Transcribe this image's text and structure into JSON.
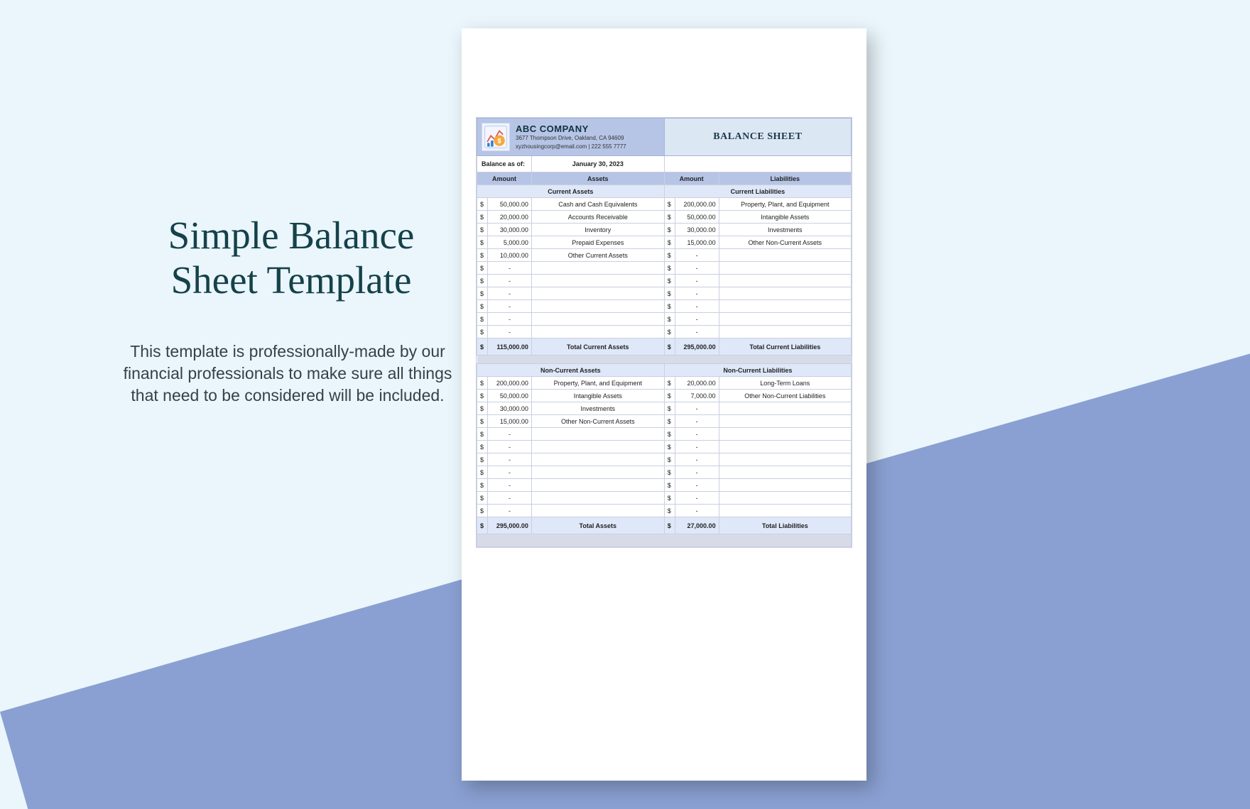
{
  "page": {
    "title": "Simple Balance Sheet Template",
    "description": "This template is professionally-made by our financial professionals to make sure all things that need to be considered will be included."
  },
  "header": {
    "company": "ABC COMPANY",
    "address": "3677 Thompson Drive, Oakland, CA 94609",
    "contact": "xyzhousingcorp@email.com | 222 555 7777",
    "doc_title": "BALANCE SHEET"
  },
  "info": {
    "label": "Balance as of:",
    "date": "January 30, 2023"
  },
  "columns": {
    "amount": "Amount",
    "assets": "Assets",
    "liabilities": "Liabilities"
  },
  "sections": {
    "current_assets": "Current Assets",
    "current_liabilities": "Current Liabilities",
    "non_current_assets": "Non-Current Assets",
    "non_current_liabilities": "Non-Current Liabilities"
  },
  "totals": {
    "tca_label": "Total Current Assets",
    "tca_amount": "115,000.00",
    "tcl_label": "Total Current Liabilities",
    "tcl_amount": "295,000.00",
    "ta_label": "Total Assets",
    "ta_amount": "295,000.00",
    "tl_label": "Total Liabilities",
    "tl_amount": "27,000.00"
  },
  "currency": "$",
  "dash": "-",
  "ca": [
    {
      "amt": "50,000.00",
      "lbl": "Cash and Cash Equivalents"
    },
    {
      "amt": "20,000.00",
      "lbl": "Accounts Receivable"
    },
    {
      "amt": "30,000.00",
      "lbl": "Inventory"
    },
    {
      "amt": "5,000.00",
      "lbl": "Prepaid Expenses"
    },
    {
      "amt": "10,000.00",
      "lbl": "Other Current Assets"
    },
    {
      "amt": "-",
      "lbl": ""
    },
    {
      "amt": "-",
      "lbl": ""
    },
    {
      "amt": "-",
      "lbl": ""
    },
    {
      "amt": "-",
      "lbl": ""
    },
    {
      "amt": "-",
      "lbl": ""
    },
    {
      "amt": "-",
      "lbl": ""
    }
  ],
  "cl": [
    {
      "amt": "200,000.00",
      "lbl": "Property, Plant, and Equipment"
    },
    {
      "amt": "50,000.00",
      "lbl": "Intangible Assets"
    },
    {
      "amt": "30,000.00",
      "lbl": "Investments"
    },
    {
      "amt": "15,000.00",
      "lbl": "Other Non-Current Assets"
    },
    {
      "amt": "-",
      "lbl": ""
    },
    {
      "amt": "-",
      "lbl": ""
    },
    {
      "amt": "-",
      "lbl": ""
    },
    {
      "amt": "-",
      "lbl": ""
    },
    {
      "amt": "-",
      "lbl": ""
    },
    {
      "amt": "-",
      "lbl": ""
    },
    {
      "amt": "-",
      "lbl": ""
    }
  ],
  "nca": [
    {
      "amt": "200,000.00",
      "lbl": "Property, Plant, and Equipment"
    },
    {
      "amt": "50,000.00",
      "lbl": "Intangible Assets"
    },
    {
      "amt": "30,000.00",
      "lbl": "Investments"
    },
    {
      "amt": "15,000.00",
      "lbl": "Other Non-Current Assets"
    },
    {
      "amt": "-",
      "lbl": ""
    },
    {
      "amt": "-",
      "lbl": ""
    },
    {
      "amt": "-",
      "lbl": ""
    },
    {
      "amt": "-",
      "lbl": ""
    },
    {
      "amt": "-",
      "lbl": ""
    },
    {
      "amt": "-",
      "lbl": ""
    },
    {
      "amt": "-",
      "lbl": ""
    }
  ],
  "ncl": [
    {
      "amt": "20,000.00",
      "lbl": "Long-Term Loans"
    },
    {
      "amt": "7,000.00",
      "lbl": "Other Non-Current Liabilities"
    },
    {
      "amt": "-",
      "lbl": ""
    },
    {
      "amt": "-",
      "lbl": ""
    },
    {
      "amt": "-",
      "lbl": ""
    },
    {
      "amt": "-",
      "lbl": ""
    },
    {
      "amt": "-",
      "lbl": ""
    },
    {
      "amt": "-",
      "lbl": ""
    },
    {
      "amt": "-",
      "lbl": ""
    },
    {
      "amt": "-",
      "lbl": ""
    },
    {
      "amt": "-",
      "lbl": ""
    }
  ]
}
